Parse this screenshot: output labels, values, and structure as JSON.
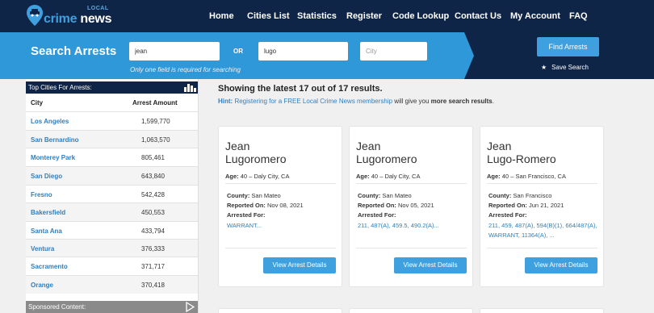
{
  "brand": {
    "small": "LOCAL",
    "name_a": "crime",
    "name_b": " news"
  },
  "nav": {
    "items": [
      "Home",
      "Cities List",
      "Statistics",
      "Register",
      "Code Lookup",
      "Contact Us",
      "My Account",
      "FAQ"
    ]
  },
  "search": {
    "title": "Search Arrests",
    "first_value": "jean",
    "or": "OR",
    "last_value": "lugo",
    "city_placeholder": "City",
    "hint": "Only one field is required for searching",
    "find_label": "Find Arrests",
    "save_label": "Save Search"
  },
  "sidebar": {
    "title": "Top Cities For Arrests:",
    "col_city": "City",
    "col_amount": "Arrest Amount",
    "rows": [
      {
        "city": "Los Angeles",
        "amount": "1,599,770"
      },
      {
        "city": "San Bernardino",
        "amount": "1,063,570"
      },
      {
        "city": "Monterey Park",
        "amount": "805,461"
      },
      {
        "city": "San Diego",
        "amount": "643,840"
      },
      {
        "city": "Fresno",
        "amount": "542,428"
      },
      {
        "city": "Bakersfield",
        "amount": "450,553"
      },
      {
        "city": "Santa Ana",
        "amount": "433,794"
      },
      {
        "city": "Ventura",
        "amount": "376,333"
      },
      {
        "city": "Sacramento",
        "amount": "371,717"
      },
      {
        "city": "Orange",
        "amount": "370,418"
      }
    ],
    "sponsored": "Sponsored Content:"
  },
  "results": {
    "title": "Showing the latest 17 out of 17 results.",
    "hint_label": "Hint:",
    "hint_link": "Registering for a FREE Local Crime News membership",
    "hint_mid": " will give you ",
    "hint_bold": "more search results",
    "hint_end": "."
  },
  "labels": {
    "age": "Age:",
    "county": "County:",
    "reported": "Reported On:",
    "arrested": "Arrested For:",
    "button": "View Arrest Details"
  },
  "cards": [
    {
      "first": "Jean",
      "last": "Lugoromero",
      "age": "40 – Daly City, CA",
      "county": "San Mateo",
      "reported": "Nov 08, 2021",
      "charges": "WARRANT..."
    },
    {
      "first": "Jean",
      "last": "Lugoromero",
      "age": "40 – Daly City, CA",
      "county": "San Mateo",
      "reported": "Nov 05, 2021",
      "charges": "211, 487(A), 459.5, 490.2(A)..."
    },
    {
      "first": "Jean",
      "last": "Lugo-Romero",
      "age": "40 – San Francisco, CA",
      "county": "San Francisco",
      "reported": "Jun 21, 2021",
      "charges": "211, 459, 487(A), 594(B)(1), 664/487(A), WARRANT, 11364(A), ..."
    }
  ],
  "colors": {
    "nav_bg": "#0f2547",
    "search_bg": "#2f98d8",
    "accent": "#3fa0e0",
    "link": "#2f7fc0"
  }
}
